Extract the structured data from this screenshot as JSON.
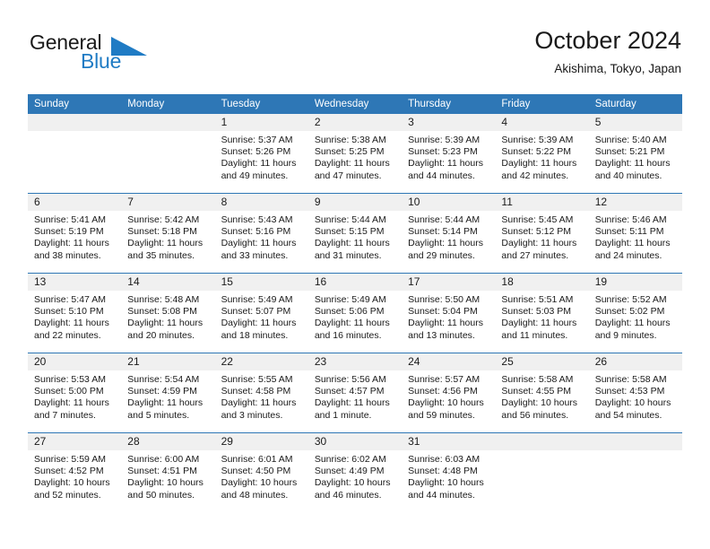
{
  "brand": {
    "name_part1": "General",
    "name_part2": "Blue",
    "triangle_color": "#1f7bc4",
    "text_color": "#1a1a1a"
  },
  "header": {
    "title": "October 2024",
    "location": "Akishima, Tokyo, Japan"
  },
  "theme": {
    "header_blue": "#2e77b6",
    "band_gray": "#f0f0f0",
    "text": "#1a1a1a"
  },
  "weekdays": [
    "Sunday",
    "Monday",
    "Tuesday",
    "Wednesday",
    "Thursday",
    "Friday",
    "Saturday"
  ],
  "weeks": [
    [
      {
        "date": "",
        "sunrise": "",
        "sunset": "",
        "daylight": "",
        "empty": true
      },
      {
        "date": "",
        "sunrise": "",
        "sunset": "",
        "daylight": "",
        "empty": true
      },
      {
        "date": "1",
        "sunrise": "Sunrise: 5:37 AM",
        "sunset": "Sunset: 5:26 PM",
        "daylight": "Daylight: 11 hours and 49 minutes."
      },
      {
        "date": "2",
        "sunrise": "Sunrise: 5:38 AM",
        "sunset": "Sunset: 5:25 PM",
        "daylight": "Daylight: 11 hours and 47 minutes."
      },
      {
        "date": "3",
        "sunrise": "Sunrise: 5:39 AM",
        "sunset": "Sunset: 5:23 PM",
        "daylight": "Daylight: 11 hours and 44 minutes."
      },
      {
        "date": "4",
        "sunrise": "Sunrise: 5:39 AM",
        "sunset": "Sunset: 5:22 PM",
        "daylight": "Daylight: 11 hours and 42 minutes."
      },
      {
        "date": "5",
        "sunrise": "Sunrise: 5:40 AM",
        "sunset": "Sunset: 5:21 PM",
        "daylight": "Daylight: 11 hours and 40 minutes."
      }
    ],
    [
      {
        "date": "6",
        "sunrise": "Sunrise: 5:41 AM",
        "sunset": "Sunset: 5:19 PM",
        "daylight": "Daylight: 11 hours and 38 minutes."
      },
      {
        "date": "7",
        "sunrise": "Sunrise: 5:42 AM",
        "sunset": "Sunset: 5:18 PM",
        "daylight": "Daylight: 11 hours and 35 minutes."
      },
      {
        "date": "8",
        "sunrise": "Sunrise: 5:43 AM",
        "sunset": "Sunset: 5:16 PM",
        "daylight": "Daylight: 11 hours and 33 minutes."
      },
      {
        "date": "9",
        "sunrise": "Sunrise: 5:44 AM",
        "sunset": "Sunset: 5:15 PM",
        "daylight": "Daylight: 11 hours and 31 minutes."
      },
      {
        "date": "10",
        "sunrise": "Sunrise: 5:44 AM",
        "sunset": "Sunset: 5:14 PM",
        "daylight": "Daylight: 11 hours and 29 minutes."
      },
      {
        "date": "11",
        "sunrise": "Sunrise: 5:45 AM",
        "sunset": "Sunset: 5:12 PM",
        "daylight": "Daylight: 11 hours and 27 minutes."
      },
      {
        "date": "12",
        "sunrise": "Sunrise: 5:46 AM",
        "sunset": "Sunset: 5:11 PM",
        "daylight": "Daylight: 11 hours and 24 minutes."
      }
    ],
    [
      {
        "date": "13",
        "sunrise": "Sunrise: 5:47 AM",
        "sunset": "Sunset: 5:10 PM",
        "daylight": "Daylight: 11 hours and 22 minutes."
      },
      {
        "date": "14",
        "sunrise": "Sunrise: 5:48 AM",
        "sunset": "Sunset: 5:08 PM",
        "daylight": "Daylight: 11 hours and 20 minutes."
      },
      {
        "date": "15",
        "sunrise": "Sunrise: 5:49 AM",
        "sunset": "Sunset: 5:07 PM",
        "daylight": "Daylight: 11 hours and 18 minutes."
      },
      {
        "date": "16",
        "sunrise": "Sunrise: 5:49 AM",
        "sunset": "Sunset: 5:06 PM",
        "daylight": "Daylight: 11 hours and 16 minutes."
      },
      {
        "date": "17",
        "sunrise": "Sunrise: 5:50 AM",
        "sunset": "Sunset: 5:04 PM",
        "daylight": "Daylight: 11 hours and 13 minutes."
      },
      {
        "date": "18",
        "sunrise": "Sunrise: 5:51 AM",
        "sunset": "Sunset: 5:03 PM",
        "daylight": "Daylight: 11 hours and 11 minutes."
      },
      {
        "date": "19",
        "sunrise": "Sunrise: 5:52 AM",
        "sunset": "Sunset: 5:02 PM",
        "daylight": "Daylight: 11 hours and 9 minutes."
      }
    ],
    [
      {
        "date": "20",
        "sunrise": "Sunrise: 5:53 AM",
        "sunset": "Sunset: 5:00 PM",
        "daylight": "Daylight: 11 hours and 7 minutes."
      },
      {
        "date": "21",
        "sunrise": "Sunrise: 5:54 AM",
        "sunset": "Sunset: 4:59 PM",
        "daylight": "Daylight: 11 hours and 5 minutes."
      },
      {
        "date": "22",
        "sunrise": "Sunrise: 5:55 AM",
        "sunset": "Sunset: 4:58 PM",
        "daylight": "Daylight: 11 hours and 3 minutes."
      },
      {
        "date": "23",
        "sunrise": "Sunrise: 5:56 AM",
        "sunset": "Sunset: 4:57 PM",
        "daylight": "Daylight: 11 hours and 1 minute."
      },
      {
        "date": "24",
        "sunrise": "Sunrise: 5:57 AM",
        "sunset": "Sunset: 4:56 PM",
        "daylight": "Daylight: 10 hours and 59 minutes."
      },
      {
        "date": "25",
        "sunrise": "Sunrise: 5:58 AM",
        "sunset": "Sunset: 4:55 PM",
        "daylight": "Daylight: 10 hours and 56 minutes."
      },
      {
        "date": "26",
        "sunrise": "Sunrise: 5:58 AM",
        "sunset": "Sunset: 4:53 PM",
        "daylight": "Daylight: 10 hours and 54 minutes."
      }
    ],
    [
      {
        "date": "27",
        "sunrise": "Sunrise: 5:59 AM",
        "sunset": "Sunset: 4:52 PM",
        "daylight": "Daylight: 10 hours and 52 minutes."
      },
      {
        "date": "28",
        "sunrise": "Sunrise: 6:00 AM",
        "sunset": "Sunset: 4:51 PM",
        "daylight": "Daylight: 10 hours and 50 minutes."
      },
      {
        "date": "29",
        "sunrise": "Sunrise: 6:01 AM",
        "sunset": "Sunset: 4:50 PM",
        "daylight": "Daylight: 10 hours and 48 minutes."
      },
      {
        "date": "30",
        "sunrise": "Sunrise: 6:02 AM",
        "sunset": "Sunset: 4:49 PM",
        "daylight": "Daylight: 10 hours and 46 minutes."
      },
      {
        "date": "31",
        "sunrise": "Sunrise: 6:03 AM",
        "sunset": "Sunset: 4:48 PM",
        "daylight": "Daylight: 10 hours and 44 minutes."
      },
      {
        "date": "",
        "sunrise": "",
        "sunset": "",
        "daylight": "",
        "empty": true
      },
      {
        "date": "",
        "sunrise": "",
        "sunset": "",
        "daylight": "",
        "empty": true
      }
    ]
  ]
}
